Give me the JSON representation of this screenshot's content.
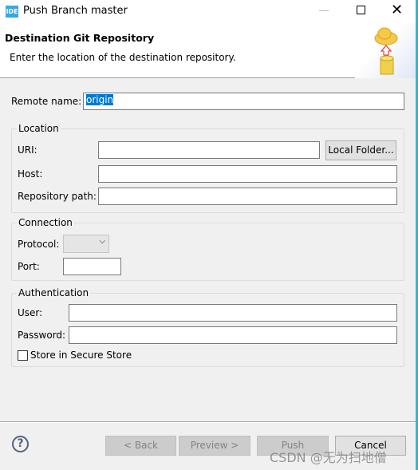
{
  "window": {
    "title": "Push Branch master",
    "app_icon": "IDE"
  },
  "header": {
    "title": "Destination Git Repository",
    "description": "Enter the location of the destination repository.",
    "banner_icon": "cloud-push-icon"
  },
  "remote": {
    "label": "Remote name:",
    "value": "origin"
  },
  "location": {
    "legend": "Location",
    "uri_label": "URI:",
    "uri_value": "",
    "local_folder_button": "Local Folder...",
    "host_label": "Host:",
    "host_value": "",
    "repo_path_label": "Repository path:",
    "repo_path_value": ""
  },
  "connection": {
    "legend": "Connection",
    "protocol_label": "Protocol:",
    "protocol_value": "",
    "port_label": "Port:",
    "port_value": ""
  },
  "authentication": {
    "legend": "Authentication",
    "user_label": "User:",
    "user_value": "",
    "password_label": "Password:",
    "password_value": "",
    "store_label": "Store in Secure Store",
    "store_checked": false
  },
  "footer": {
    "back": "< Back",
    "preview": "Preview >",
    "push": "Push",
    "cancel": "Cancel"
  },
  "watermark": "CSDN @无为扫地僧"
}
